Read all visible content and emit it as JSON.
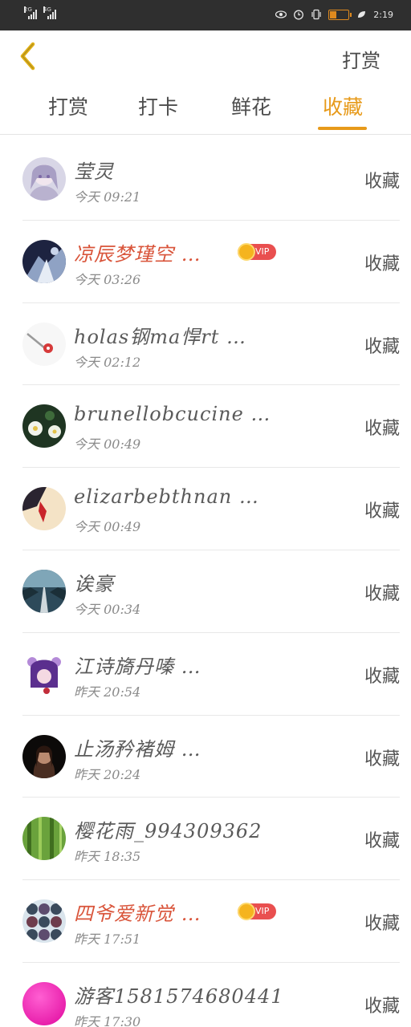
{
  "status_bar": {
    "sim1": "2G",
    "sim2": "4G",
    "time": "2:19",
    "battery_level": 0.35,
    "icons": [
      "eye-icon",
      "alarm-icon",
      "vibrate-icon",
      "battery-icon",
      "leaf-icon"
    ]
  },
  "header": {
    "back_icon": "chevron-left-icon",
    "action_label": "打赏"
  },
  "tabs": [
    {
      "label": "打赏"
    },
    {
      "label": "打卡"
    },
    {
      "label": "鲜花"
    },
    {
      "label": "收藏"
    }
  ],
  "active_tab": 3,
  "accent_color": "#e79a1a",
  "vip_name_color": "#d9543a",
  "vip_badge_label": "VIP",
  "users": [
    {
      "name": "莹灵",
      "time": "今天 09:21",
      "action": "收藏",
      "vip": false
    },
    {
      "name": "凉辰梦瑾空 …",
      "time": "今天 03:26",
      "action": "收藏",
      "vip": true
    },
    {
      "name": "holas钢ma悍rt …",
      "time": "今天 02:12",
      "action": "收藏",
      "vip": false
    },
    {
      "name": "brunellobcucine …",
      "time": "今天 00:49",
      "action": "收藏",
      "vip": false
    },
    {
      "name": "elizarbebthnan …",
      "time": "今天 00:49",
      "action": "收藏",
      "vip": false
    },
    {
      "name": "诶豪",
      "time": "今天 00:34",
      "action": "收藏",
      "vip": false
    },
    {
      "name": "江诗旖丹嗪 …",
      "time": "昨天 20:54",
      "action": "收藏",
      "vip": false
    },
    {
      "name": "止汤矜褚姆 …",
      "time": "昨天 20:24",
      "action": "收藏",
      "vip": false
    },
    {
      "name": "樱花雨_994309362",
      "time": "昨天 18:35",
      "action": "收藏",
      "vip": false
    },
    {
      "name": "四爷爱新觉 …",
      "time": "昨天 17:51",
      "action": "收藏",
      "vip": true
    },
    {
      "name": "游客1581574680441",
      "time": "昨天 17:30",
      "action": "收藏",
      "vip": false
    }
  ]
}
